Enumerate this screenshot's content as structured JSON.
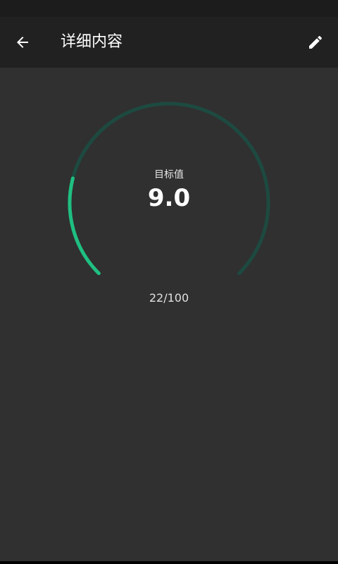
{
  "header": {
    "title": "详细内容",
    "back_icon": "arrow-left-icon",
    "edit_icon": "pencil-icon"
  },
  "gauge": {
    "label": "目标值",
    "value": "9.0",
    "progress_text": "22/100",
    "progress_fraction": 0.22,
    "colors": {
      "track": "#1d4a40",
      "fill": "#1fbf81"
    }
  },
  "colors": {
    "background": "#303030",
    "app_bar": "#212121",
    "status_bar": "#1c1c1c"
  }
}
